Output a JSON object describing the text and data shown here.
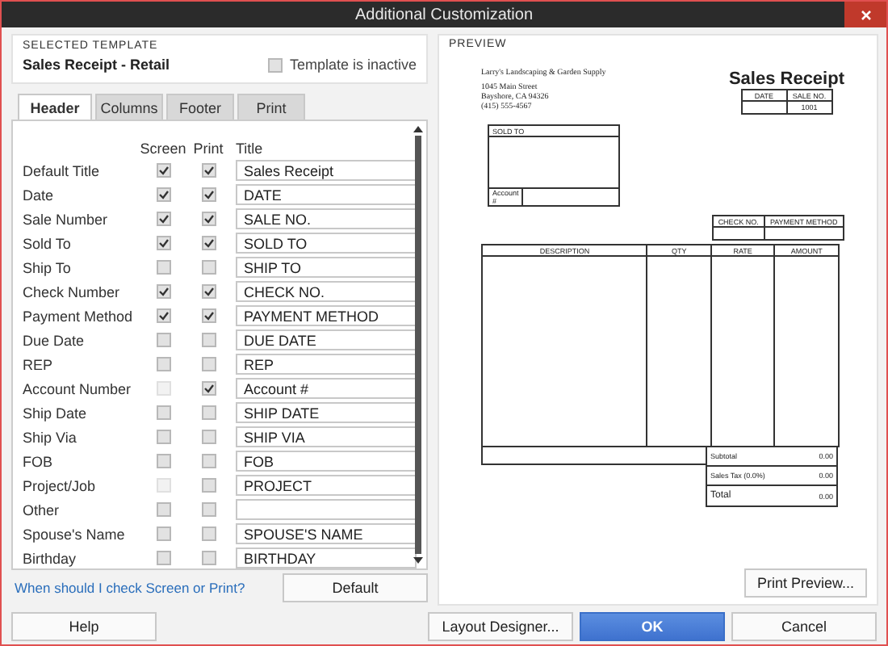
{
  "window": {
    "title": "Additional Customization"
  },
  "selected_template": {
    "heading": "SELECTED TEMPLATE",
    "name": "Sales Receipt - Retail",
    "inactive_checkbox": {
      "label": "Template is inactive",
      "checked": false
    }
  },
  "tabs": [
    {
      "label": "Header",
      "selected": true
    },
    {
      "label": "Columns",
      "selected": false
    },
    {
      "label": "Footer",
      "selected": false
    },
    {
      "label": "Print",
      "selected": false
    }
  ],
  "columns": [
    "Screen",
    "Print",
    "Title"
  ],
  "fields": [
    {
      "name": "Default Title",
      "screen_checked": true,
      "screen_disabled": false,
      "print_checked": true,
      "title": "Sales Receipt"
    },
    {
      "name": "Date",
      "screen_checked": true,
      "screen_disabled": false,
      "print_checked": true,
      "title": "DATE"
    },
    {
      "name": "Sale Number",
      "screen_checked": true,
      "screen_disabled": false,
      "print_checked": true,
      "title": "SALE NO."
    },
    {
      "name": "Sold To",
      "screen_checked": true,
      "screen_disabled": false,
      "print_checked": true,
      "title": "SOLD TO"
    },
    {
      "name": "Ship To",
      "screen_checked": false,
      "screen_disabled": false,
      "print_checked": false,
      "title": "SHIP TO"
    },
    {
      "name": "Check Number",
      "screen_checked": true,
      "screen_disabled": false,
      "print_checked": true,
      "title": "CHECK NO."
    },
    {
      "name": "Payment Method",
      "screen_checked": true,
      "screen_disabled": false,
      "print_checked": true,
      "title": "PAYMENT METHOD"
    },
    {
      "name": "Due Date",
      "screen_checked": false,
      "screen_disabled": false,
      "print_checked": false,
      "title": "DUE DATE"
    },
    {
      "name": "REP",
      "screen_checked": false,
      "screen_disabled": false,
      "print_checked": false,
      "title": "REP"
    },
    {
      "name": "Account Number",
      "screen_checked": false,
      "screen_disabled": true,
      "print_checked": true,
      "title": "Account #"
    },
    {
      "name": "Ship Date",
      "screen_checked": false,
      "screen_disabled": false,
      "print_checked": false,
      "title": "SHIP DATE"
    },
    {
      "name": "Ship Via",
      "screen_checked": false,
      "screen_disabled": false,
      "print_checked": false,
      "title": "SHIP VIA"
    },
    {
      "name": "FOB",
      "screen_checked": false,
      "screen_disabled": false,
      "print_checked": false,
      "title": "FOB"
    },
    {
      "name": "Project/Job",
      "screen_checked": false,
      "screen_disabled": true,
      "print_checked": false,
      "title": "PROJECT"
    },
    {
      "name": "Other",
      "screen_checked": false,
      "screen_disabled": false,
      "print_checked": false
    },
    {
      "name": "Spouse's Name",
      "screen_checked": false,
      "screen_disabled": false,
      "print_checked": false,
      "title": "SPOUSE'S NAME"
    },
    {
      "name": "Birthday",
      "screen_checked": false,
      "screen_disabled": false,
      "print_checked": false,
      "title": "BIRTHDAY"
    }
  ],
  "help_link": "When should I check Screen or Print?",
  "default_button": "Default",
  "preview": {
    "heading": "PREVIEW",
    "print_preview_button": "Print Preview...",
    "document": {
      "company_lines": [
        "Larry's Landscaping & Garden Supply",
        "1045 Main Street",
        "Bayshore, CA 94326",
        "(415) 555-4567"
      ],
      "title": "Sales Receipt",
      "header_columns": [
        "DATE",
        "SALE NO."
      ],
      "sale_number": "1001",
      "sold_to_label": "SOLD TO",
      "account_label": "Account #",
      "payment_columns": [
        "CHECK NO.",
        "PAYMENT METHOD"
      ],
      "item_columns": [
        "DESCRIPTION",
        "QTY",
        "RATE",
        "AMOUNT"
      ],
      "totals": [
        {
          "label": "Subtotal",
          "value": "0.00"
        },
        {
          "label": "Sales Tax (0.0%)",
          "value": "0.00"
        },
        {
          "label": "Total",
          "value": "0.00"
        }
      ]
    }
  },
  "buttons": [
    {
      "label": "Help",
      "kind": "normal"
    },
    {
      "label": "Layout Designer...",
      "kind": "normal"
    },
    {
      "label": "OK",
      "kind": "primary"
    },
    {
      "label": "Cancel",
      "kind": "normal"
    }
  ]
}
